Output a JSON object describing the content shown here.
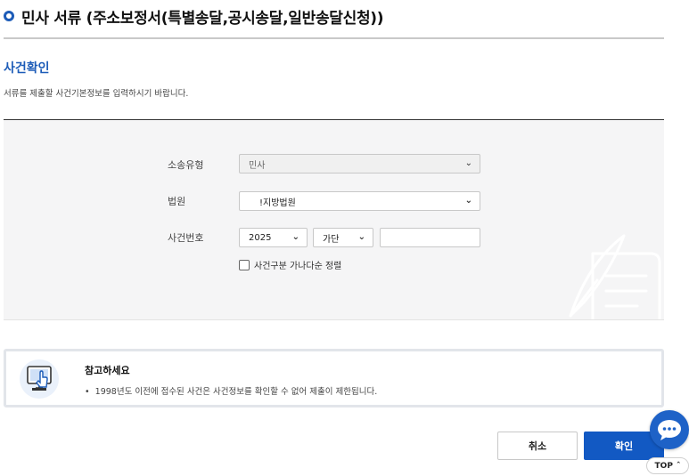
{
  "header": {
    "title": "민사 서류 (주소보정서(특별송달,공시송달,일반송달신청))"
  },
  "section": {
    "title": "사건확인",
    "description": "서류를 제출할 사건기본정보를 입력하시기 바랍니다."
  },
  "form": {
    "lawsuit_type": {
      "label": "소송유형",
      "value": "민사"
    },
    "court": {
      "label": "법원",
      "value": "!지방법원"
    },
    "case_number": {
      "label": "사건번호",
      "year": "2025",
      "category": "가단",
      "number": ""
    },
    "sort_checkbox": {
      "label": "사건구분 가나다순 정렬",
      "checked": false
    }
  },
  "notice": {
    "title": "참고하세요",
    "items": [
      "1998년도 이전에 접수된 사건은 사건정보를 확인할 수 없어 제출이 제한됩니다."
    ]
  },
  "buttons": {
    "cancel": "취소",
    "confirm": "확인"
  },
  "floating": {
    "top_label": "TOP"
  },
  "colors": {
    "accent": "#1d5cb8",
    "primary_button": "#1259c3"
  }
}
